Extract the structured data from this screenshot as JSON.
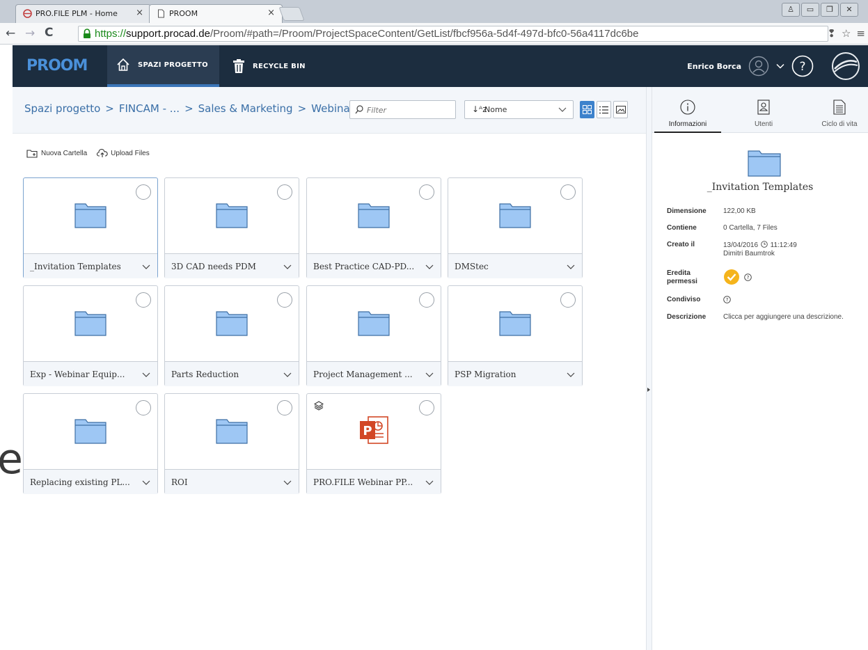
{
  "browser": {
    "tabs": [
      {
        "title": "PRO.FILE PLM - Home",
        "active": false
      },
      {
        "title": "PROOM",
        "active": true
      }
    ],
    "url": {
      "scheme": "https://",
      "host": "support.procad.de",
      "path": "/Proom/#path=/Proom/ProjectSpaceContent/GetList/fbcf956a-5d4f-497d-bfc0-56a4117dc6be"
    }
  },
  "header": {
    "logo": "PROOM",
    "nav": [
      {
        "label": "SPAZI PROGETTO",
        "icon": "home-icon",
        "active": true
      },
      {
        "label": "RECYCLE BIN",
        "icon": "trash-icon",
        "active": false
      }
    ],
    "user": "Enrico Borca",
    "accent": "#3b75b8",
    "bg": "#1c2d3f"
  },
  "breadcrumb": [
    "Spazi progetto",
    "FINCAM - ...",
    "Sales & Marketing",
    "Webinars"
  ],
  "breadcrumb_sep": ">",
  "filter": {
    "placeholder": "Filter",
    "value": ""
  },
  "sort": {
    "label": "Nome",
    "icon": "sort-az-icon"
  },
  "view_modes": [
    {
      "name": "grid-view",
      "active": true
    },
    {
      "name": "list-view",
      "active": false
    },
    {
      "name": "preview-view",
      "active": false
    }
  ],
  "actions": [
    {
      "label": "Nuova Cartella",
      "icon": "new-folder-icon"
    },
    {
      "label": "Upload Files",
      "icon": "upload-cloud-icon"
    }
  ],
  "items": [
    {
      "name": "_Invitation Templates",
      "type": "folder",
      "selected": true
    },
    {
      "name": "3D CAD needs PDM",
      "type": "folder",
      "selected": false
    },
    {
      "name": "Best Practice CAD-PD...",
      "type": "folder",
      "selected": false
    },
    {
      "name": "DMStec",
      "type": "folder",
      "selected": false
    },
    {
      "name": "Exp - Webinar Equip...",
      "type": "folder",
      "selected": false
    },
    {
      "name": "Parts Reduction",
      "type": "folder",
      "selected": false
    },
    {
      "name": "Project Management ...",
      "type": "folder",
      "selected": false
    },
    {
      "name": "PSP Migration",
      "type": "folder",
      "selected": false
    },
    {
      "name": "Replacing existing PL...",
      "type": "folder",
      "selected": false
    },
    {
      "name": "ROI",
      "type": "folder",
      "selected": false
    },
    {
      "name": "PRO.FILE Webinar PP...",
      "type": "powerpoint",
      "selected": false
    }
  ],
  "panel": {
    "tabs": [
      {
        "label": "Informazioni",
        "icon": "info-icon",
        "active": true
      },
      {
        "label": "Utenti",
        "icon": "user-card-icon",
        "active": false
      },
      {
        "label": "Ciclo di vita",
        "icon": "document-icon",
        "active": false
      }
    ],
    "title": "_Invitation Templates",
    "props": {
      "dimensione_label": "Dimensione",
      "dimensione": "122,00 KB",
      "contiene_label": "Contiene",
      "contiene": "0 Cartella, 7 Files",
      "creato_label": "Creato il",
      "creato_date": "13/04/2016",
      "creato_time": "11:12:49",
      "creato_by": "Dimitri Baumtrok",
      "eredita_label_1": "Eredita",
      "eredita_label_2": "permessi",
      "condiviso_label": "Condiviso",
      "descrizione_label": "Descrizione",
      "descrizione": "Clicca per aggiungere una descrizione."
    }
  },
  "colors": {
    "folder_fill": "#9ec7f4",
    "folder_stroke": "#3f6fa3",
    "link": "#3a6fa7",
    "check": "#f5b41c",
    "ppt": "#d24726"
  },
  "overlay_glyph": "e"
}
